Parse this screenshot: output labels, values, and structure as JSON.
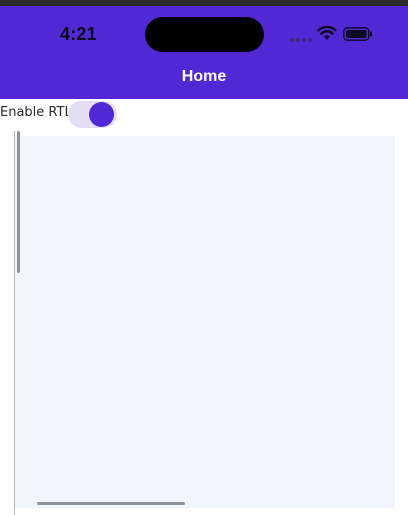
{
  "status_bar": {
    "time": "4:21",
    "icons": [
      "signal-dots-icon",
      "wifi-icon",
      "battery-icon"
    ]
  },
  "header": {
    "title": "Home"
  },
  "rtl_toggle": {
    "label": "Enable RTL",
    "checked": true
  },
  "colors": {
    "primary": "#5128d4",
    "toggle_track": "#e4ddf6",
    "content_bg": "#eff6fe",
    "scrollbar": "#8e9299"
  }
}
